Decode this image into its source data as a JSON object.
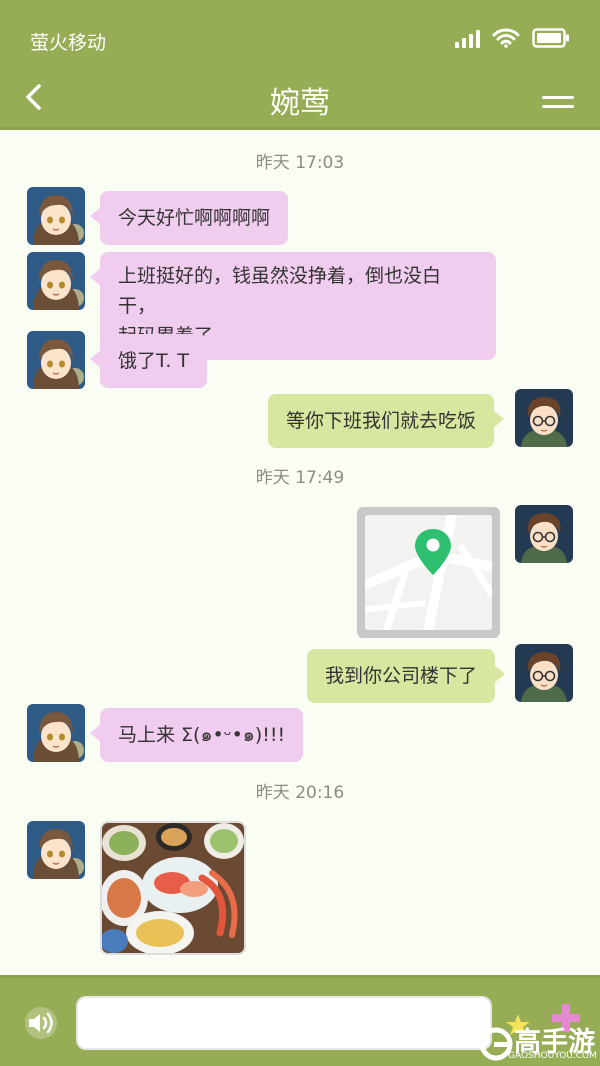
{
  "status_bar": {
    "carrier": "萤火移动"
  },
  "header": {
    "title": "婉莺"
  },
  "chat": {
    "time_labels": [
      "昨天 17:03",
      "昨天 17:49",
      "昨天 20:16"
    ],
    "messages": [
      {
        "from": "left",
        "text": "今天好忙啊啊啊啊"
      },
      {
        "from": "left",
        "line1": "上班挺好的，钱虽然没挣着，倒也没白干，",
        "line2": "起码累着了"
      },
      {
        "from": "left",
        "text": "饿了T. T"
      },
      {
        "from": "right",
        "text": "等你下班我们就去吃饭"
      },
      {
        "from": "right",
        "type": "map",
        "icon": "location-pin-icon"
      },
      {
        "from": "right",
        "text": "我到你公司楼下了"
      },
      {
        "from": "left",
        "text": "马上来 Σ(๑•ᵕ•๑)!!!"
      },
      {
        "from": "left",
        "type": "image",
        "description": "food-photo"
      }
    ]
  },
  "input_bar": {
    "placeholder": "",
    "voice_icon": "speaker-icon"
  },
  "watermark": {
    "text": "高手游",
    "sub": "GAOSHOUYOU.COM"
  },
  "colors": {
    "accent": "#97ad55",
    "bubble_left": "#f0cdee",
    "bubble_right": "#d7e79f",
    "background": "#fafdf3",
    "map_pin": "#2fbf71"
  }
}
